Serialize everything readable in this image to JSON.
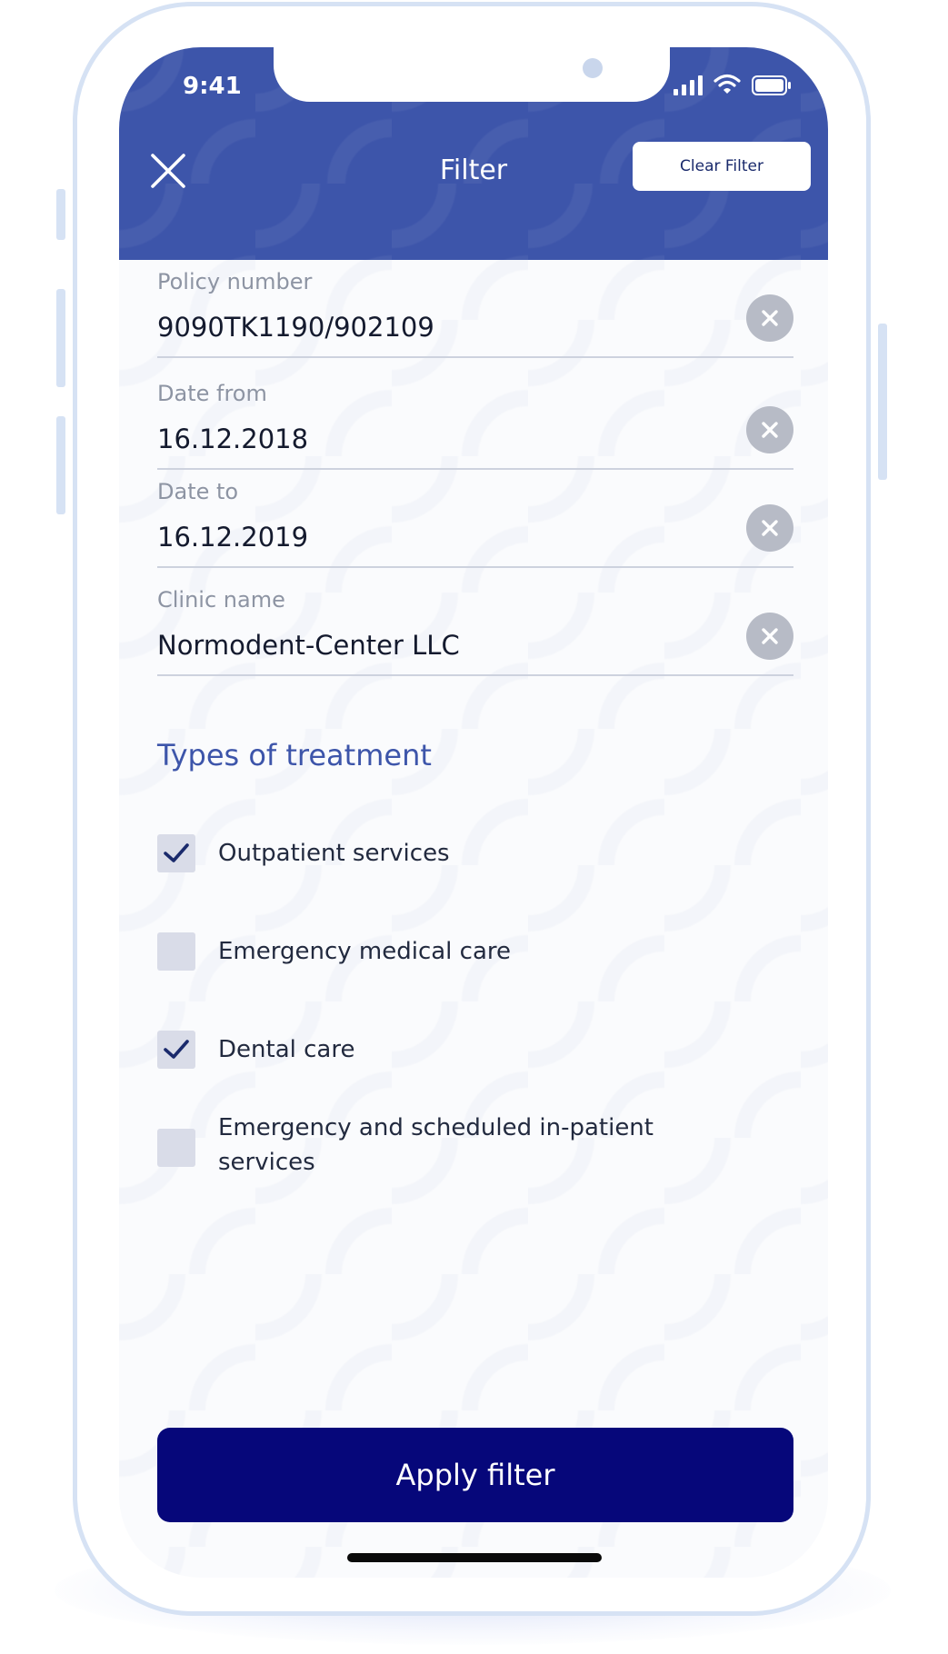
{
  "status_bar": {
    "time": "9:41"
  },
  "header": {
    "title": "Filter",
    "clear_filter_label": "Clear Filter"
  },
  "fields": [
    {
      "label": "Policy number",
      "value": "9090TK1190/902109"
    },
    {
      "label": "Date from",
      "value": "16.12.2018"
    },
    {
      "label": "Date to",
      "value": "16.12.2019"
    },
    {
      "label": "Clinic name",
      "value": "Normodent-Center LLC"
    }
  ],
  "treatment": {
    "title": "Types of treatment",
    "options": [
      {
        "label": "Outpatient services",
        "checked": true
      },
      {
        "label": "Emergency medical care",
        "checked": false
      },
      {
        "label": "Dental care",
        "checked": true
      },
      {
        "label": "Emergency and scheduled in-patient services",
        "checked": false
      }
    ]
  },
  "apply_label": "Apply filter",
  "icons": {
    "close": "close-icon",
    "clear_field": "clear-field-icon",
    "checkmark": "checkmark-icon",
    "signal": "signal-icon",
    "wifi": "wifi-icon",
    "battery": "battery-icon"
  },
  "colors": {
    "header": "#3d55aa",
    "primary_button": "#06077a",
    "section_title": "#3d55aa",
    "checkbox": "#d9dce8",
    "checkmark": "#1a2a6c",
    "clear_icon": "#b7bbc6",
    "phone_frame": "#d6e2f4"
  }
}
